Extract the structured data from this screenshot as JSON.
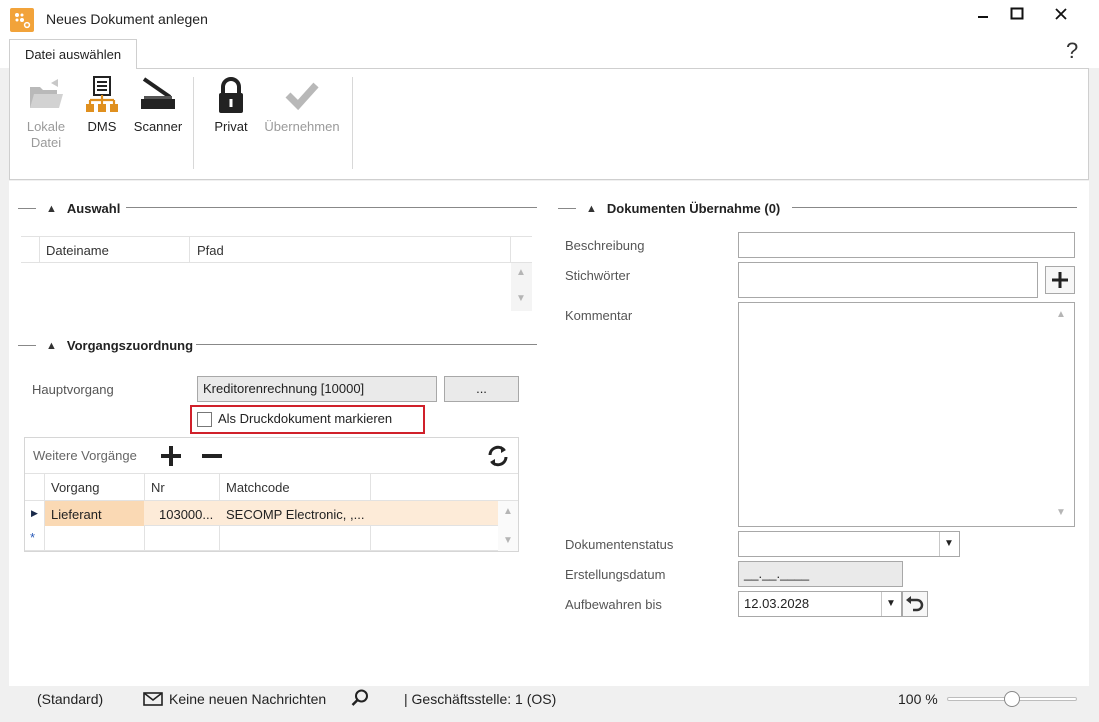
{
  "window": {
    "title": "Neues Dokument anlegen",
    "minimize": "–",
    "maximize": "☐",
    "close": "✕"
  },
  "ribbon": {
    "tab": "Datei auswählen",
    "help": "?",
    "buttons": {
      "lokale_line1": "Lokale",
      "lokale_line2": "Datei",
      "dms": "DMS",
      "scanner": "Scanner",
      "privat": "Privat",
      "uebernehmen": "Übernehmen"
    }
  },
  "auswahl": {
    "title": "Auswahl",
    "columns": [
      "Dateiname",
      "Pfad"
    ]
  },
  "vorgang": {
    "title": "Vorgangszuordnung",
    "hauptvorgang_label": "Hauptvorgang",
    "hauptvorgang_value": "Kreditorenrechnung [10000]",
    "browse_label": "...",
    "druck_label": "Als Druckdokument markieren",
    "weitere_label": "Weitere Vorgänge",
    "columns": [
      "Vorgang",
      "Nr",
      "Matchcode"
    ],
    "rows": [
      {
        "vorgang": "Lieferant",
        "nr": "103000...",
        "matchcode": "SECOMP Electronic, ,..."
      }
    ]
  },
  "uebernahme": {
    "title": "Dokumenten Übernahme (0)",
    "beschreibung_label": "Beschreibung",
    "stichwoerter_label": "Stichwörter",
    "kommentar_label": "Kommentar",
    "status_label": "Dokumentenstatus",
    "erstellung_label": "Erstellungsdatum",
    "erstellung_value": "__.__.____",
    "aufbewahren_label": "Aufbewahren bis",
    "aufbewahren_value": "12.03.2028"
  },
  "statusbar": {
    "standard": "(Standard)",
    "nachrichten": "Keine neuen Nachrichten",
    "geschaeftsstelle": "| Geschäftsstelle:  1 (OS)",
    "zoom": "100 %",
    "zoom_level": 0.5
  },
  "colors": {
    "accent_orange": "#f2a33a",
    "selected_cell": "#fad9b4",
    "row_highlight": "#fdebd8",
    "highlight_box": "#d0202a"
  }
}
